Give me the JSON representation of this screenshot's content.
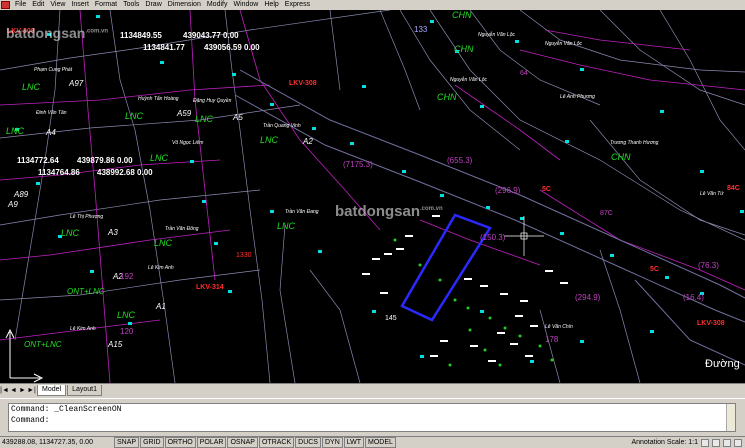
{
  "menubar": {
    "items": [
      "File",
      "Edit",
      "View",
      "Insert",
      "Format",
      "Tools",
      "Draw",
      "Dimension",
      "Modify",
      "Window",
      "Help",
      "Express"
    ]
  },
  "watermark": {
    "logo_top": "batdongsan",
    "logo_top_suffix": ".com.vn",
    "logo_mid": "batdongsan",
    "logo_mid_suffix": ".com.vn"
  },
  "drawing": {
    "coords": [
      "1134849.55",
      "439043.77 0.00",
      "1134841.77",
      "439056.59 0.00",
      "1134772.64",
      "439879.86 0.00",
      "1134764.86",
      "438992.68 0.00"
    ],
    "owners": [
      "Phạm Cung Phát",
      "Đinh Văn Tân",
      "Huỳnh Tấn Hoàng",
      "Đặng Huy Quyền",
      "Võ Ngọc Liêm",
      "Trần Quang Vinh",
      "Trần Văn Đang",
      "Lê Thị Phượng",
      "Trần Văn Đông",
      "Lê Kim Anh",
      "Lê Kim Anh",
      "Nguyễn Văn Lộc",
      "Nguyễn Văn Lộc",
      "Nguyễn Văn Lộc",
      "Lê Anh Phương",
      "Trương Thanh Hương",
      "Lê Văn Chín",
      "Lê Văn Tứ"
    ],
    "parcel_codes": [
      "A97",
      "A59",
      "A5",
      "A2",
      "A3",
      "A2",
      "A1",
      "A15",
      "A4",
      "A9",
      "A89"
    ],
    "areas": [
      "(7175.3)",
      "(296.9)",
      "(655.3)",
      "(150.3)",
      "(294.9)",
      "(76.3)",
      "(16.4)"
    ],
    "road_labels": [
      "LKV-308",
      "LKV-308",
      "LKV-314",
      "LKV-308",
      "Đường"
    ],
    "numbers": [
      "133",
      "1330",
      "145",
      "192",
      "120",
      "178",
      "5C",
      "5C",
      "64",
      "84C",
      "87C"
    ],
    "land_types": [
      "LNC",
      "LNC",
      "LNC",
      "LNC",
      "LNC",
      "LNC",
      "LNC",
      "LNC",
      "LNC",
      "LNC",
      "CHN",
      "CHN",
      "CHN",
      "CHN",
      "ONT+LNC",
      "ONT+LNC"
    ]
  },
  "layout_tabs": {
    "nav": [
      "|◄",
      "◄",
      "►",
      "►|"
    ],
    "tabs": [
      "Model",
      "Layout1"
    ],
    "active": "Model"
  },
  "command": {
    "line1": "Command: _CleanScreenON",
    "line2": "Command:"
  },
  "status": {
    "coordinates": "439288.08, 1134727.35, 0.00",
    "toggles": [
      "SNAP",
      "GRID",
      "ORTHO",
      "POLAR",
      "OSNAP",
      "OTRACK",
      "DUCS",
      "DYN",
      "LWT",
      "MODEL"
    ],
    "annotation_scale_label": "Annotation Scale:",
    "annotation_scale_value": "1:1"
  }
}
